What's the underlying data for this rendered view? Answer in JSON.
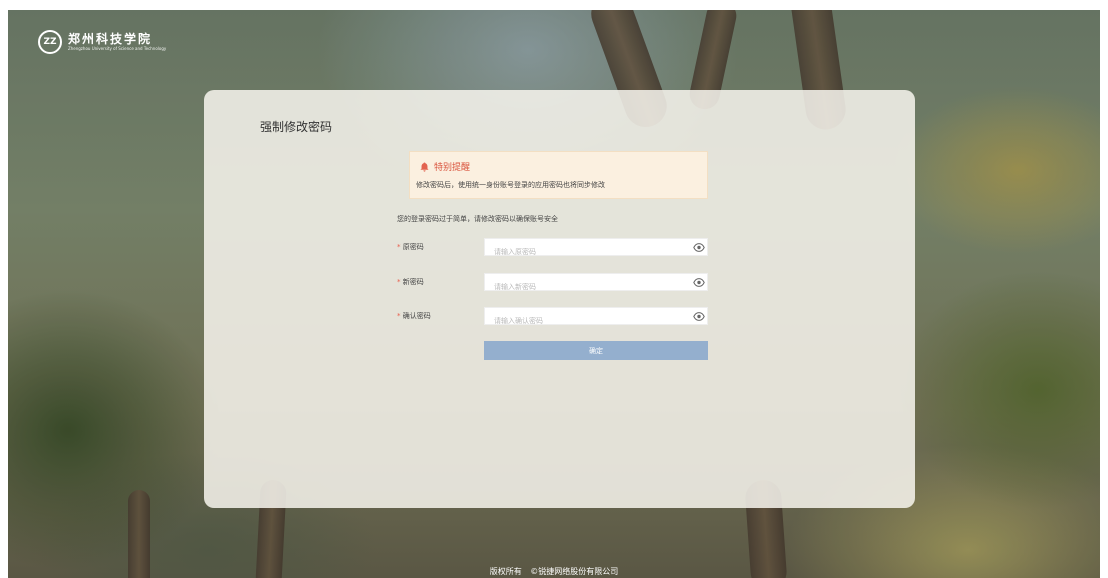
{
  "logo": {
    "emblem_text": "ZZ",
    "name_cn": "郑州科技学院",
    "name_en": "Zhengzhou University of Science and Technology"
  },
  "card": {
    "title": "强制修改密码"
  },
  "notice": {
    "icon": "bell-icon",
    "title": "特别提醒",
    "body": "修改密码后，使用统一身份账号登录的应用密码也将同步修改"
  },
  "hint": "您的登录密码过于简单，请修改密码以确保账号安全",
  "form": {
    "required_mark": "*",
    "fields": [
      {
        "label": "原密码",
        "placeholder": "请输入原密码",
        "value": ""
      },
      {
        "label": "新密码",
        "placeholder": "请输入新密码",
        "value": ""
      },
      {
        "label": "确认密码",
        "placeholder": "请输入确认密码",
        "value": ""
      }
    ],
    "submit_label": "确定"
  },
  "footer": {
    "rights": "版权所有",
    "company": "©锐捷网络股份有限公司"
  },
  "colors": {
    "accent_button": "#94afce",
    "required": "#e85c4a",
    "notice_title": "#d9533c",
    "notice_bg": "#fbf0e0"
  }
}
